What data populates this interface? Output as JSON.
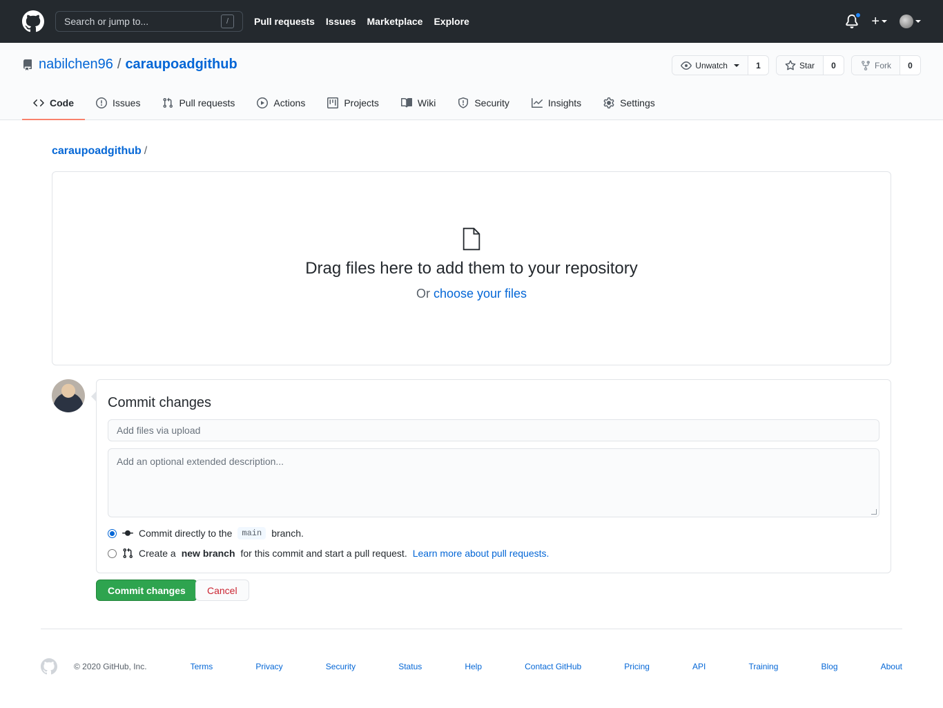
{
  "header": {
    "search_placeholder": "Search or jump to...",
    "search_shortcut": "/",
    "nav": [
      "Pull requests",
      "Issues",
      "Marketplace",
      "Explore"
    ]
  },
  "repo": {
    "owner": "nabilchen96",
    "separator": "/",
    "name": "caraupoadgithub",
    "watch_label": "Unwatch",
    "watch_count": "1",
    "star_label": "Star",
    "star_count": "0",
    "fork_label": "Fork",
    "fork_count": "0",
    "tabs": [
      "Code",
      "Issues",
      "Pull requests",
      "Actions",
      "Projects",
      "Wiki",
      "Security",
      "Insights",
      "Settings"
    ]
  },
  "breadcrumb": {
    "root": "caraupoadgithub",
    "sep": "/"
  },
  "dropzone": {
    "heading": "Drag files here to add them to your repository",
    "or_text": "Or",
    "choose_link": "choose your files"
  },
  "commit": {
    "title": "Commit changes",
    "summary_placeholder": "Add files via upload",
    "description_placeholder": "Add an optional extended description...",
    "option_direct_prefix": "Commit directly to the",
    "branch": "main",
    "option_direct_suffix": "branch.",
    "option_new_prefix": "Create a",
    "option_new_bold": "new branch",
    "option_new_middle": "for this commit and start a pull request.",
    "option_new_link": "Learn more about pull requests.",
    "submit_label": "Commit changes",
    "cancel_label": "Cancel"
  },
  "footer": {
    "copyright": "© 2020 GitHub, Inc.",
    "links": [
      "Terms",
      "Privacy",
      "Security",
      "Status",
      "Help",
      "Contact GitHub",
      "Pricing",
      "API",
      "Training",
      "Blog",
      "About"
    ]
  },
  "colors": {
    "header_bg": "#24292e",
    "link": "#0366d6",
    "primary_button": "#2ea44f",
    "cancel_text": "#cb2431",
    "active_tab_underline": "#f9826c",
    "notification_dot": "#2188ff"
  }
}
